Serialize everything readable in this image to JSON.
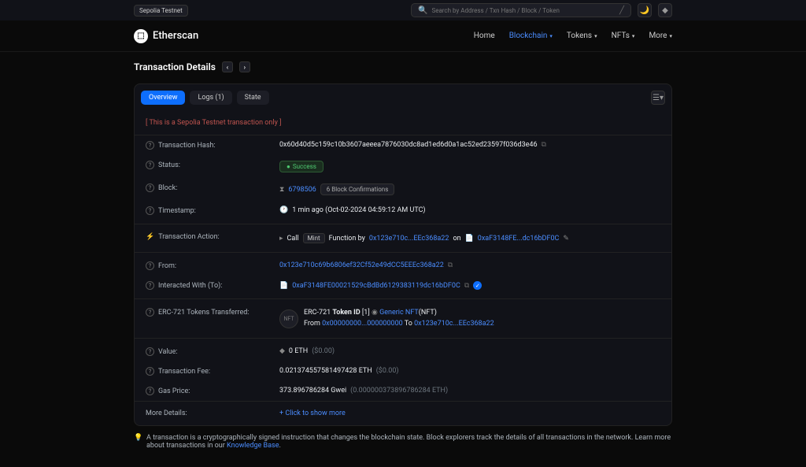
{
  "topbar": {
    "testnet_badge": "Sepolia Testnet",
    "search_placeholder": "Search by Address / Txn Hash / Block / Token"
  },
  "brand": "Etherscan",
  "nav": {
    "home": "Home",
    "blockchain": "Blockchain",
    "tokens": "Tokens",
    "nfts": "NFTs",
    "more": "More"
  },
  "page_title": "Transaction Details",
  "tabs": {
    "overview": "Overview",
    "logs": "Logs (1)",
    "state": "State"
  },
  "notice": "[ This is a Sepolia Testnet transaction only ]",
  "labels": {
    "tx_hash": "Transaction Hash:",
    "status": "Status:",
    "block": "Block:",
    "timestamp": "Timestamp:",
    "tx_action": "Transaction Action:",
    "from": "From:",
    "interacted": "Interacted With (To):",
    "erc721": "ERC-721 Tokens Transferred:",
    "value": "Value:",
    "tx_fee": "Transaction Fee:",
    "gas_price": "Gas Price:",
    "more_details": "More Details:"
  },
  "values": {
    "tx_hash": "0x60d40d5c159c10b3607aeeea7876030dc8ad1ed6d0a1ac52ed23597f036d3e46",
    "status": "Success",
    "block_num": "6798506",
    "confirmations": "6 Block Confirmations",
    "timestamp": "1 min ago (Oct-02-2024 04:59:12 AM UTC)",
    "action_call": "Call",
    "action_mint": "Mint",
    "action_func": "Function by",
    "action_addr1": "0x123e710c...EEc368a22",
    "action_on": "on",
    "action_addr2": "0xaF3148FE...dc16bDF0C",
    "from": "0x123e710c69b6806ef32Cf52e49dCC5EEEc368a22",
    "to": "0xaF3148FE00021529cBdBd6129383119dc16bDF0C",
    "erc721_prefix": "ERC-721",
    "token_id_label": "Token ID",
    "token_id": "[1]",
    "generic_nft": "Generic NFT",
    "nft_suffix": "(NFT)",
    "nft_from": "From",
    "nft_from_addr": "0x00000000...000000000",
    "nft_to": "To",
    "nft_to_addr": "0x123e710c...EEc368a22",
    "value_eth": "0 ETH",
    "value_usd": "($0.00)",
    "tx_fee": "0.021374557581497428 ETH",
    "tx_fee_usd": "($0.00)",
    "gas_price": "373.896786284 Gwei",
    "gas_price_eth": "(0.000000373896786284 ETH)",
    "show_more": "Click to show more"
  },
  "footer": {
    "text": "A transaction is a cryptographically signed instruction that changes the blockchain state. Block explorers track the details of all transactions in the network. Learn more about transactions in our",
    "link": "Knowledge Base"
  }
}
